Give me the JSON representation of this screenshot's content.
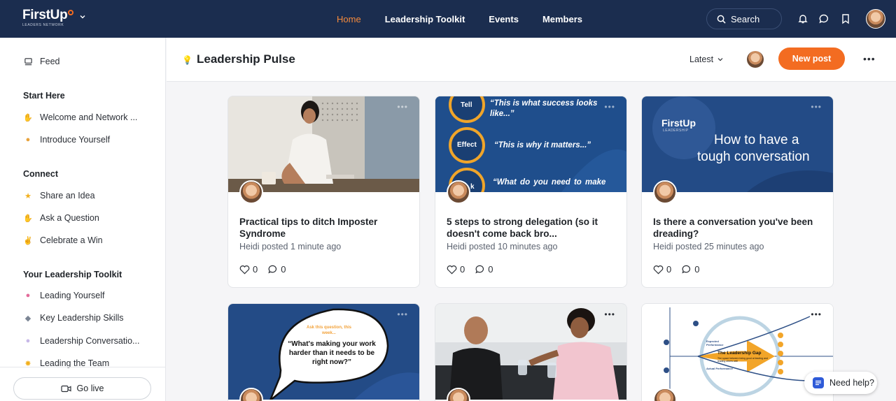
{
  "brand": {
    "name": "FirstUp",
    "tagline": "LEADERS NETWORK"
  },
  "nav": {
    "items": [
      "Home",
      "Leadership Toolkit",
      "Events",
      "Members"
    ],
    "active": "Home"
  },
  "search": {
    "label": "Search"
  },
  "sidebar": {
    "feed": "Feed",
    "sections": [
      {
        "heading": "Start Here",
        "items": [
          {
            "label": "Welcome and Network ...",
            "icon": "wave-icon"
          },
          {
            "label": "Introduce Yourself",
            "icon": "handshake-icon"
          }
        ]
      },
      {
        "heading": "Connect",
        "items": [
          {
            "label": "Share an Idea",
            "icon": "star-icon"
          },
          {
            "label": "Ask a Question",
            "icon": "raised-hand-icon"
          },
          {
            "label": "Celebrate a Win",
            "icon": "hands-up-icon"
          }
        ]
      },
      {
        "heading": "Your Leadership Toolkit",
        "items": [
          {
            "label": "Leading Yourself",
            "icon": "brain-icon"
          },
          {
            "label": "Key Leadership Skills",
            "icon": "wrench-icon"
          },
          {
            "label": "Leadership Conversatio...",
            "icon": "speech-bubble-icon"
          },
          {
            "label": "Leading the Team",
            "icon": "sparkle-icon"
          }
        ]
      }
    ],
    "go_live": "Go live"
  },
  "page": {
    "title": "Leadership Pulse",
    "sort": "Latest",
    "new_post": "New post"
  },
  "posts": [
    {
      "title": "Practical tips to ditch Imposter Syndrome",
      "meta": "Heidi posted 1 minute ago",
      "likes": "0",
      "comments": "0"
    },
    {
      "title": "5 steps to strong delegation (so it doesn't come back bro...",
      "meta": "Heidi posted 10 minutes ago",
      "likes": "0",
      "comments": "0",
      "image_text": {
        "tell": "Tell",
        "effect": "Effect",
        "k": "k",
        "line1": "“This is what success looks like...”",
        "line2": "“This is why it matters...”",
        "line3": "“What do you need to make"
      }
    },
    {
      "title": "Is there a conversation you've been dreading?",
      "meta": "Heidi posted 25 minutes ago",
      "likes": "0",
      "comments": "0",
      "image_text": {
        "logo": "FirstUp",
        "logo_sub": "LEADERSHIP",
        "headline_1": "How to have a",
        "headline_2": "tough conversation"
      }
    },
    {
      "image_text": {
        "small": "Ask this question, this week...",
        "quote": "“What's making your work harder than it needs to be right now?”"
      }
    },
    {},
    {
      "image_text": {
        "center": "The Leadership Gap",
        "center_sub": "The space between being good at leading and leading others well",
        "top": "Expected Performance",
        "bottom": "Actual Performance"
      }
    }
  ],
  "help": {
    "label": "Need help?"
  },
  "colors": {
    "navy": "#1b2d4f",
    "accent": "#f36c21"
  }
}
